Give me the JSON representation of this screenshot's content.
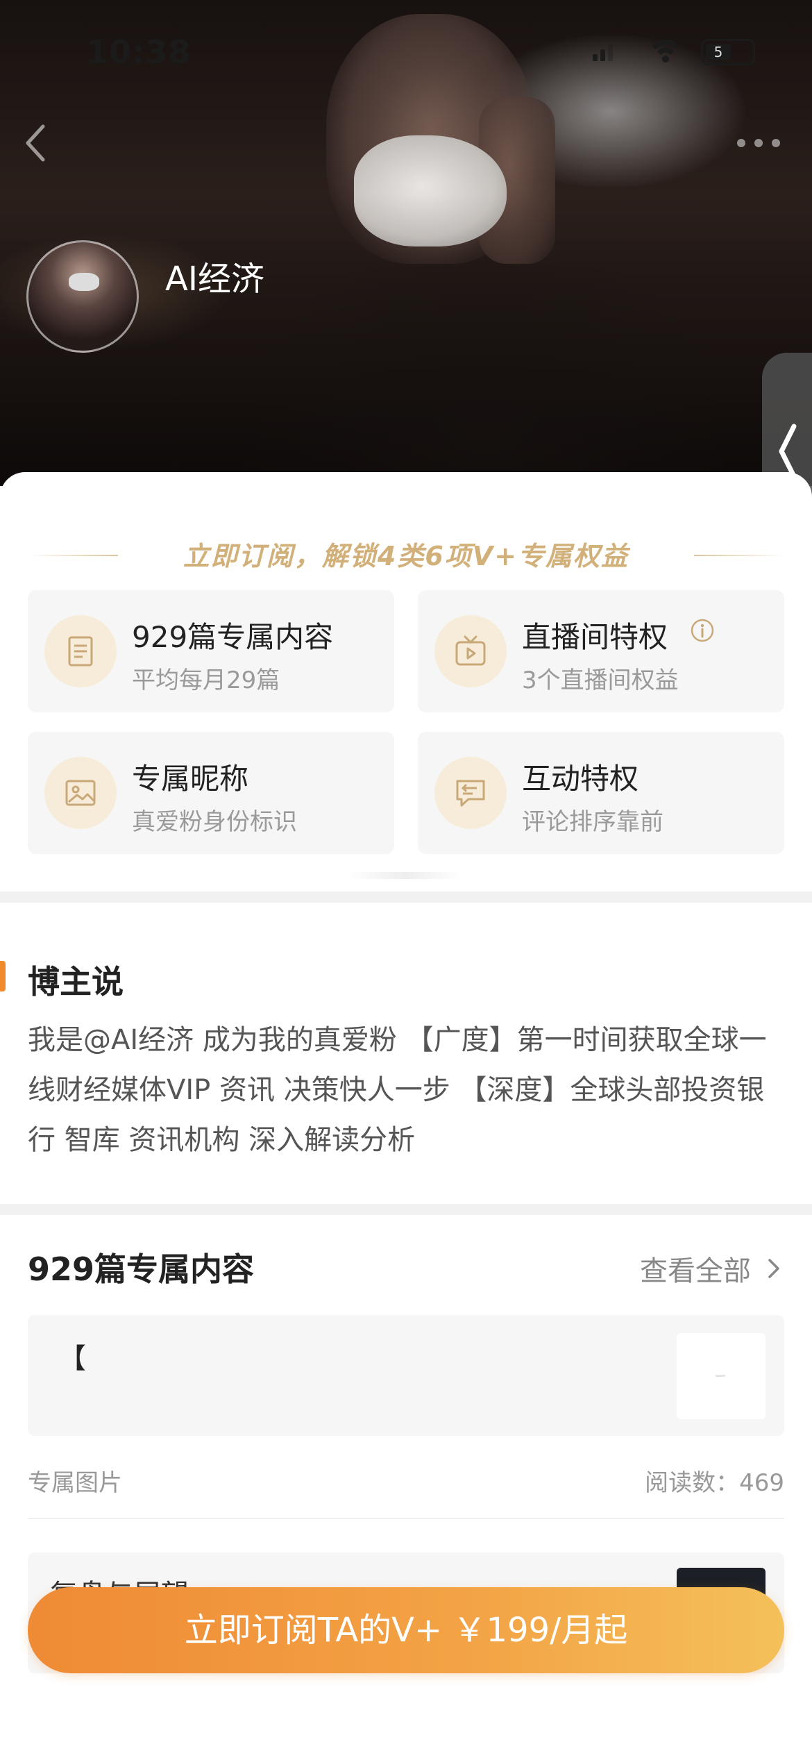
{
  "status_bar": {
    "time": "10:38",
    "battery": "5"
  },
  "profile": {
    "name": "AI经济"
  },
  "benefits": {
    "title": "立即订阅，解锁4类6项V+专属权益",
    "items": [
      {
        "title": "929篇专属内容",
        "subtitle": "平均每月29篇",
        "icon": "document-icon"
      },
      {
        "title": "直播间特权",
        "subtitle": "3个直播间权益",
        "icon": "tv-icon"
      },
      {
        "title": "专属昵称",
        "subtitle": "真爱粉身份标识",
        "icon": "image-icon"
      },
      {
        "title": "互动特权",
        "subtitle": "评论排序靠前",
        "icon": "comment-icon"
      }
    ]
  },
  "blogger": {
    "section_title": "博主说",
    "text": "我是@AI经济 成为我的真爱粉 【广度】第一时间获取全球一线财经媒体VIP 资讯 决策快人一步 【深度】全球头部投资银行 智库 资讯机构 深入解读分析"
  },
  "content": {
    "section_title": "929篇专属内容",
    "view_all": "查看全部",
    "posts": [
      {
        "title": "【",
        "tag": "专属图片",
        "reads": "阅读数：469"
      },
      {
        "title": "复盘与展望"
      }
    ]
  },
  "cta": {
    "label": "立即订阅TA的V+ ￥199/月起"
  },
  "colors": {
    "accent": "#f08a2c",
    "gold": "#d2b07a",
    "cta_start": "#ef8a35",
    "cta_end": "#f4c05a"
  }
}
